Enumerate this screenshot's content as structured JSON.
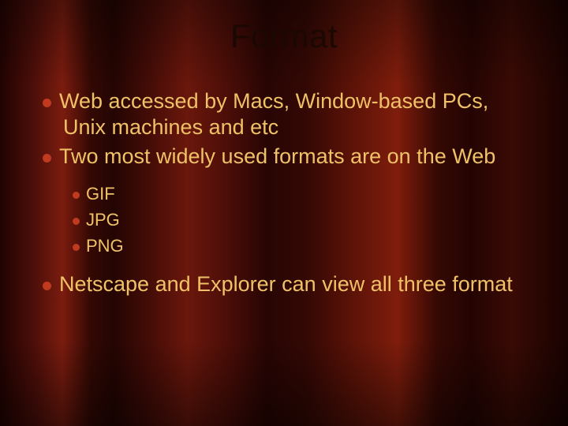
{
  "title": "Format",
  "bullets": {
    "b1": "Web accessed by Macs, Window-based PCs, Unix machines and etc",
    "b2": "Two most widely used formats are on the Web",
    "sub": {
      "s1": "GIF",
      "s2": "JPG",
      "s3": "PNG"
    },
    "b3": "Netscape and Explorer can view all three format"
  }
}
